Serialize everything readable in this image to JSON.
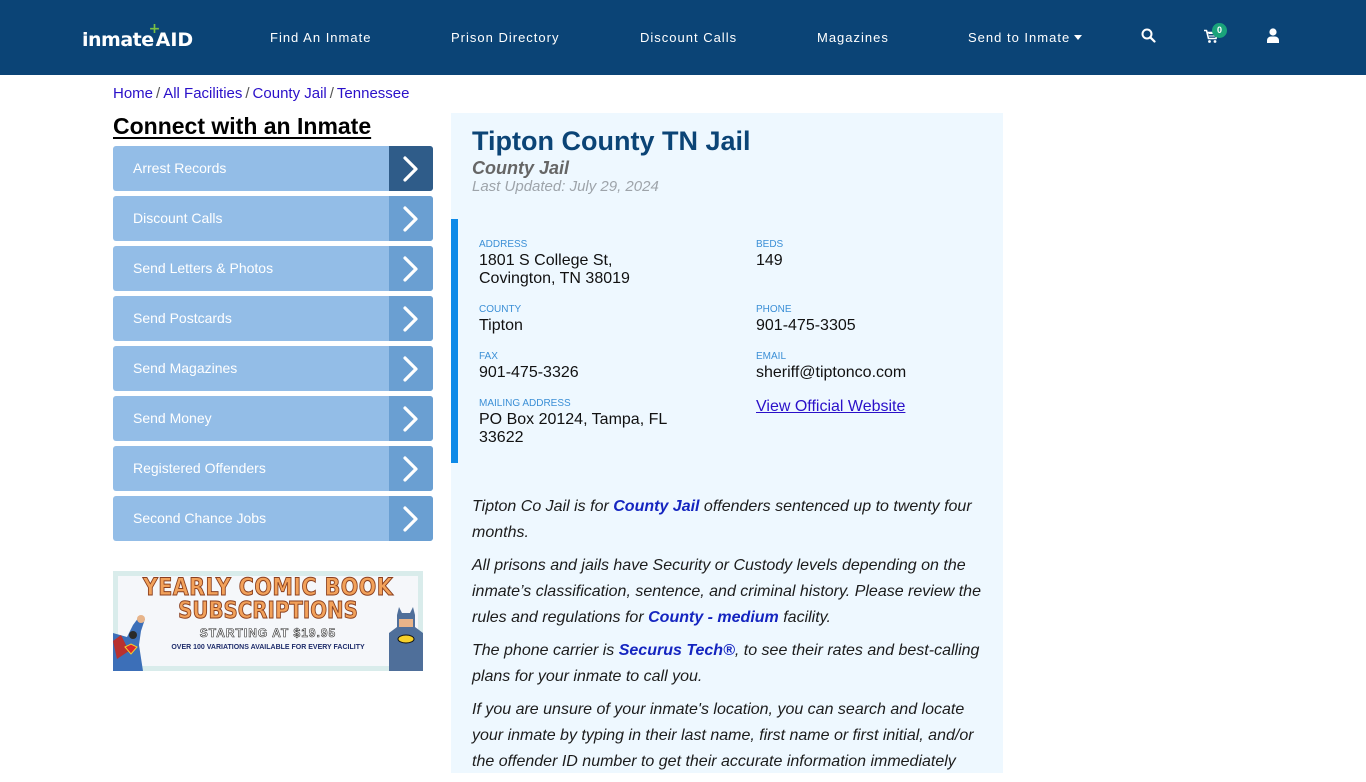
{
  "header": {
    "logo": {
      "part1": "inmate",
      "part2": "AID",
      "plus": "+"
    },
    "nav": [
      {
        "label": "Find An Inmate"
      },
      {
        "label": "Prison Directory"
      },
      {
        "label": "Discount Calls"
      },
      {
        "label": "Magazines"
      },
      {
        "label": "Send to Inmate",
        "dropdown": true
      }
    ],
    "icons": [
      "search-icon",
      "cart-icon",
      "user-icon"
    ],
    "cart_count": "0",
    "colors": {
      "background": "#0b4476",
      "badge": "#1aa37a"
    }
  },
  "breadcrumb": {
    "items": [
      "Home",
      "All Facilities",
      "County Jail",
      "Tennessee"
    ],
    "separator": "/"
  },
  "sidebar": {
    "title": "Connect with an Inmate",
    "items": [
      {
        "label": "Arrest Records",
        "active": true
      },
      {
        "label": "Discount Calls"
      },
      {
        "label": "Send Letters & Photos"
      },
      {
        "label": "Send Postcards"
      },
      {
        "label": "Send Magazines"
      },
      {
        "label": "Send Money"
      },
      {
        "label": "Registered Offenders"
      },
      {
        "label": "Second Chance Jobs"
      }
    ],
    "promo": {
      "line1": "YEARLY COMIC BOOK",
      "line2": "SUBSCRIPTIONS",
      "line3": "STARTING AT $19.95",
      "line4": "OVER 100 VARIATIONS AVAILABLE FOR EVERY FACILITY"
    },
    "colors": {
      "item": "#93bde7",
      "arrow": "#6a9fd2",
      "arrow_active": "#2f5c89"
    }
  },
  "facility": {
    "name": "Tipton County TN Jail",
    "type": "County Jail",
    "last_updated": "Last Updated: July 29, 2024",
    "fields": {
      "address": {
        "label": "ADDRESS",
        "line1": "1801 S College St,",
        "line2": "Covington, TN 38019"
      },
      "beds": {
        "label": "BEDS",
        "value": "149"
      },
      "county": {
        "label": "COUNTY",
        "value": "Tipton"
      },
      "phone": {
        "label": "PHONE",
        "value": "901-475-3305"
      },
      "fax": {
        "label": "FAX",
        "value": "901-475-3326"
      },
      "email": {
        "label": "EMAIL",
        "value": "sheriff@tiptonco.com"
      },
      "mailing": {
        "label": "MAILING ADDRESS",
        "line1": "PO Box 20124, Tampa, FL",
        "line2": "33622"
      },
      "website": {
        "label": "View Official Website"
      }
    },
    "description": {
      "p1": {
        "before": "Tipton Co Jail is for ",
        "link": "County Jail",
        "after": " offenders sentenced up to twenty four months."
      },
      "p2": {
        "before": "All prisons and jails have Security or Custody levels depending on the inmate’s classification, sentence, and criminal history. Please review the rules and regulations for ",
        "link": "County - medium",
        "after": " facility."
      },
      "p3": {
        "before": "The phone carrier is ",
        "link": "Securus Tech®",
        "after": ", to see their rates and best-calling plans for your inmate to call you."
      },
      "p4": {
        "text": "If you are unsure of your inmate's location, you can search and locate your inmate by typing in their last name, first name or first initial, and/or the offender ID number to get their accurate information immediately"
      }
    },
    "colors": {
      "title": "#0b4476",
      "panel": "#eef8ff",
      "accent_bar": "#0d8ae8",
      "label": "#3b8fd6",
      "link": "#1525c0"
    }
  }
}
